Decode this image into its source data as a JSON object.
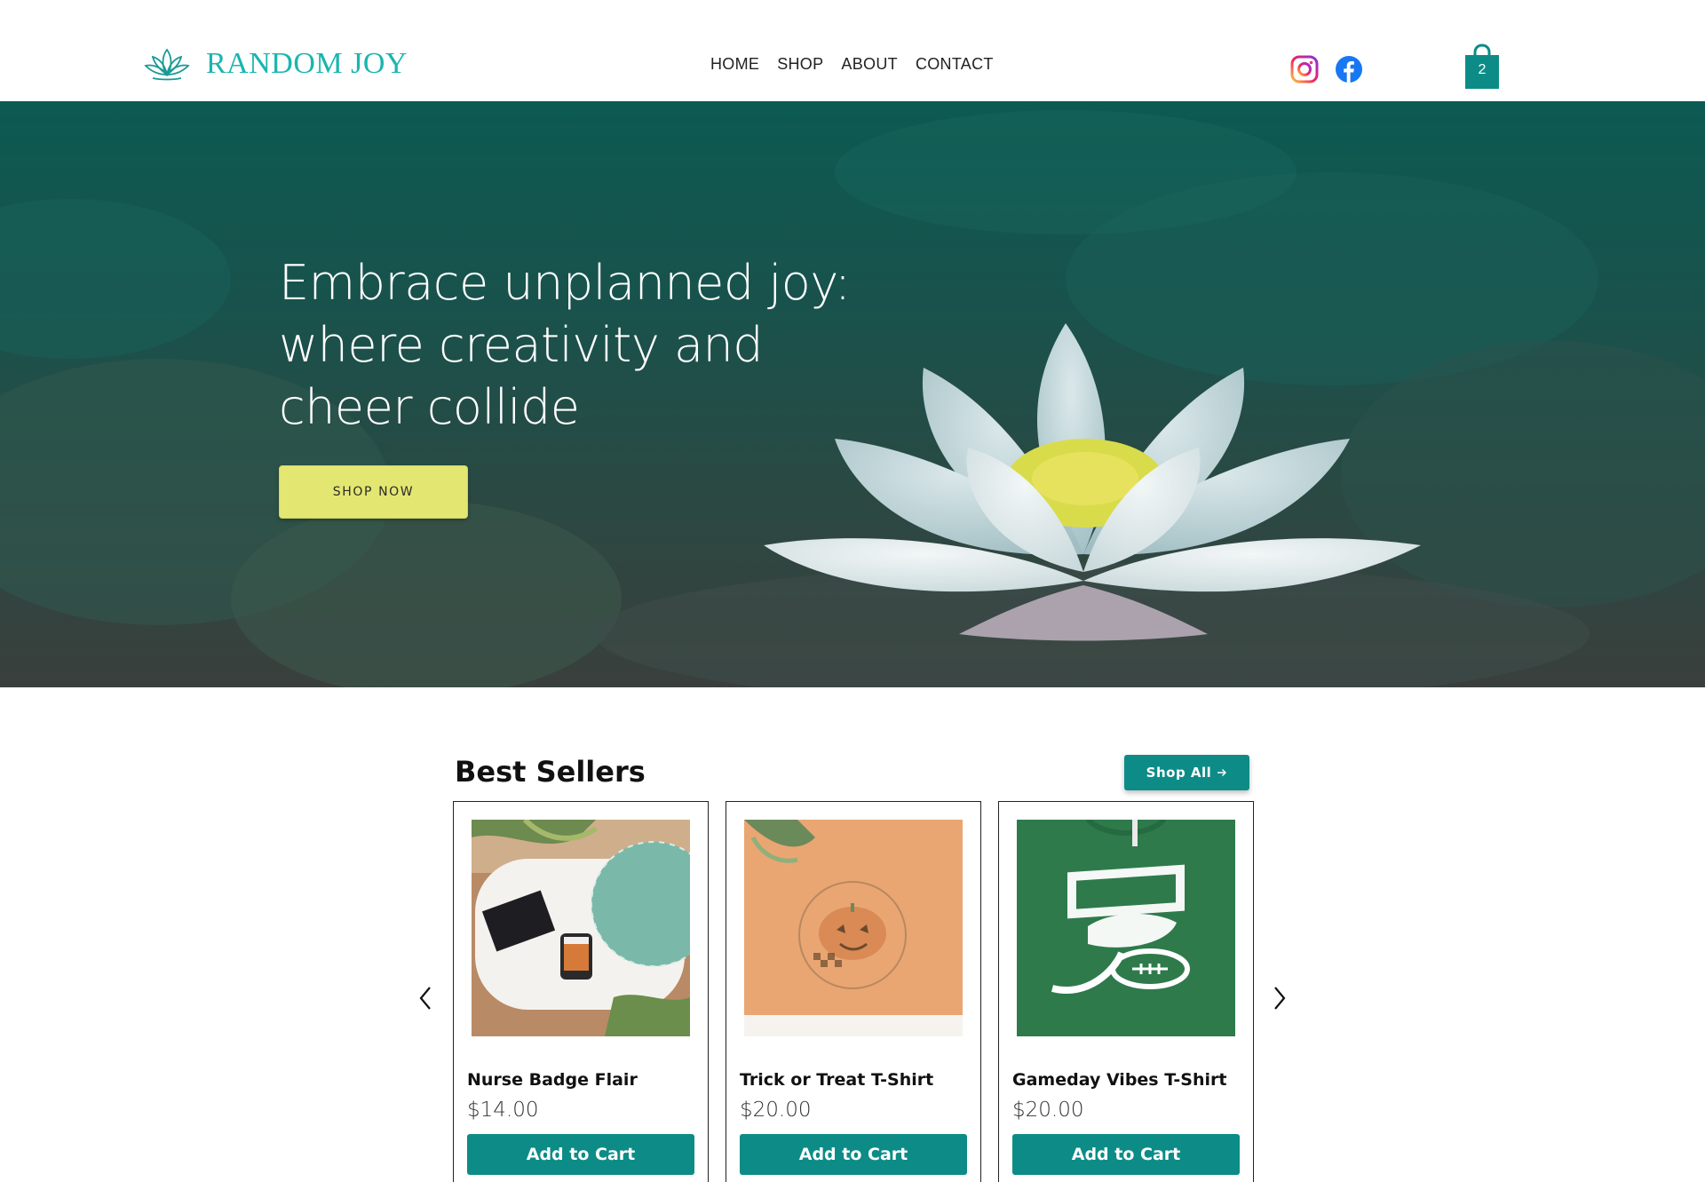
{
  "brand": {
    "name": "RANDOM JOY",
    "accent_color": "#1bb5b0",
    "logo_icon": "lotus-icon"
  },
  "nav": {
    "items": [
      {
        "label": "HOME"
      },
      {
        "label": "SHOP"
      },
      {
        "label": "ABOUT"
      },
      {
        "label": "CONTACT"
      }
    ]
  },
  "social": {
    "instagram_icon": "instagram-icon",
    "facebook_icon": "facebook-icon"
  },
  "cart": {
    "count": "2",
    "icon": "shopping-bag-icon"
  },
  "hero": {
    "title_line1": "Embrace unplanned joy:",
    "title_line2": "where creativity and",
    "title_line3": "cheer collide",
    "cta_label": "SHOP NOW",
    "cta_color": "#e3e771"
  },
  "best_sellers": {
    "title": "Best Sellers",
    "shop_all_label": "Shop All",
    "button_color": "#0d8c87",
    "products": [
      {
        "name": "Nurse Badge Flair",
        "price": "$14.00",
        "cta": "Add to Cart"
      },
      {
        "name": "Trick or Treat T-Shirt",
        "price": "$20.00",
        "cta": "Add to Cart"
      },
      {
        "name": "Gameday Vibes T-Shirt",
        "price": "$20.00",
        "cta": "Add to Cart"
      }
    ]
  }
}
